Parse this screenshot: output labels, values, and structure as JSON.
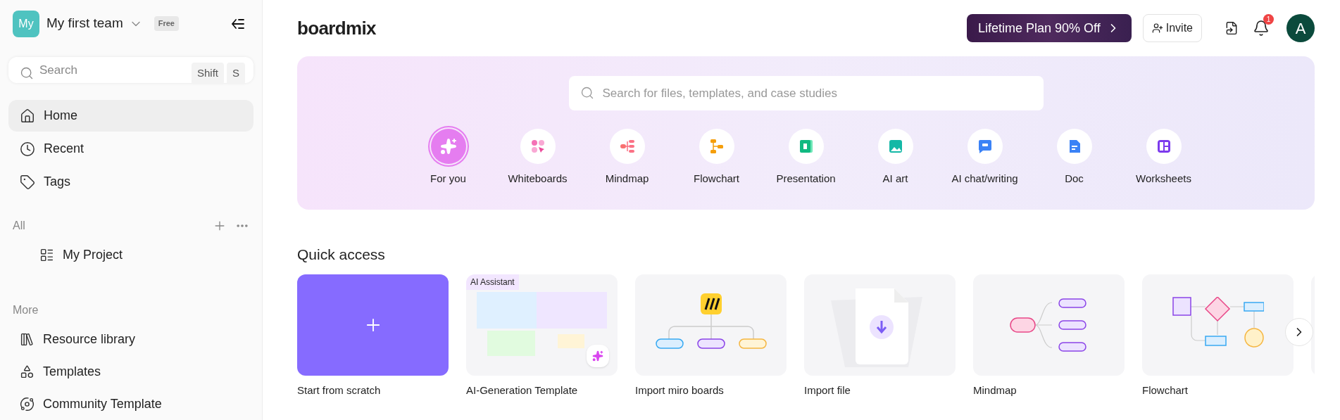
{
  "team": {
    "avatar": "My",
    "name": "My first team",
    "plan": "Free"
  },
  "search": {
    "placeholder": "Search",
    "shortcut": [
      "Shift",
      "S"
    ]
  },
  "nav": [
    {
      "label": "Home",
      "selected": true
    },
    {
      "label": "Recent",
      "selected": false
    },
    {
      "label": "Tags",
      "selected": false
    }
  ],
  "sections": [
    {
      "title": "All",
      "items": [
        {
          "label": "My Project"
        }
      ]
    },
    {
      "title": "More",
      "items": [
        {
          "label": "Resource library"
        },
        {
          "label": "Templates"
        },
        {
          "label": "Community Template"
        }
      ]
    }
  ],
  "logo": "boardmix",
  "promo": "Lifetime Plan 90% Off",
  "invite": "Invite",
  "notifications": "1",
  "user": "A",
  "hero_search": {
    "placeholder": "Search for files, templates, and case studies"
  },
  "categories": [
    {
      "label": "For you",
      "selected": true
    },
    {
      "label": "Whiteboards",
      "selected": false
    },
    {
      "label": "Mindmap",
      "selected": false
    },
    {
      "label": "Flowchart",
      "selected": false
    },
    {
      "label": "Presentation",
      "selected": false
    },
    {
      "label": "AI art",
      "selected": false
    },
    {
      "label": "AI chat/writing",
      "selected": false
    },
    {
      "label": "Doc",
      "selected": false
    },
    {
      "label": "Worksheets",
      "selected": false
    }
  ],
  "quick_access": {
    "title": "Quick access",
    "cards": [
      {
        "label": "Start from scratch",
        "kind": "blank"
      },
      {
        "label": "AI-Generation Template",
        "kind": "ai",
        "badge": "AI Assistant"
      },
      {
        "label": "Import miro boards",
        "kind": "miro"
      },
      {
        "label": "Import file",
        "kind": "file"
      },
      {
        "label": "Mindmap",
        "kind": "mindmap"
      },
      {
        "label": "Flowchart",
        "kind": "flowchart"
      },
      {
        "kind": "cut"
      }
    ]
  }
}
